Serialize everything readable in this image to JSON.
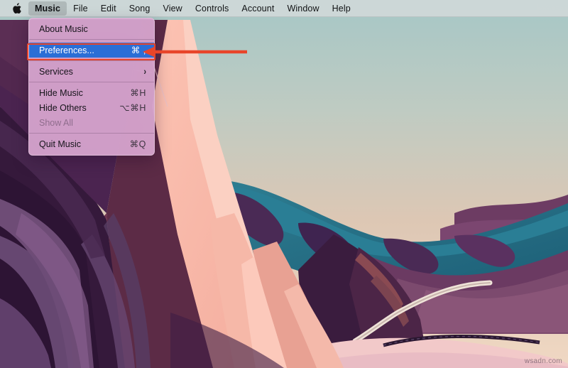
{
  "menubar": {
    "apple_icon": "apple-logo-icon",
    "items": [
      {
        "label": "Music",
        "active": true
      },
      {
        "label": "File",
        "active": false
      },
      {
        "label": "Edit",
        "active": false
      },
      {
        "label": "Song",
        "active": false
      },
      {
        "label": "View",
        "active": false
      },
      {
        "label": "Controls",
        "active": false
      },
      {
        "label": "Account",
        "active": false
      },
      {
        "label": "Window",
        "active": false
      },
      {
        "label": "Help",
        "active": false
      }
    ]
  },
  "app_menu": {
    "title": "Music",
    "items": [
      {
        "label": "About Music",
        "shortcut": "",
        "state": "normal",
        "type": "item"
      },
      {
        "type": "separator"
      },
      {
        "label": "Preferences...",
        "shortcut": "⌘ ,",
        "state": "selected",
        "type": "item"
      },
      {
        "type": "separator"
      },
      {
        "label": "Services",
        "shortcut": "",
        "state": "normal",
        "type": "submenu",
        "chevron": "›"
      },
      {
        "type": "separator"
      },
      {
        "label": "Hide Music",
        "shortcut": "⌘H",
        "state": "normal",
        "type": "item"
      },
      {
        "label": "Hide Others",
        "shortcut": "⌥⌘H",
        "state": "normal",
        "type": "item"
      },
      {
        "label": "Show All",
        "shortcut": "",
        "state": "disabled",
        "type": "item"
      },
      {
        "type": "separator"
      },
      {
        "label": "Quit Music",
        "shortcut": "⌘Q",
        "state": "normal",
        "type": "item"
      }
    ]
  },
  "annotation": {
    "highlight_color": "#e8452a",
    "arrow_color": "#e8452a",
    "arrow_direction": "left",
    "points_at": "Preferences..."
  },
  "colors": {
    "selection_blue": "#2b6ed6",
    "menu_background": "#d8a7d0",
    "menubar_background": "#d6dbdb"
  },
  "watermark": {
    "text": "wsadn.com"
  }
}
